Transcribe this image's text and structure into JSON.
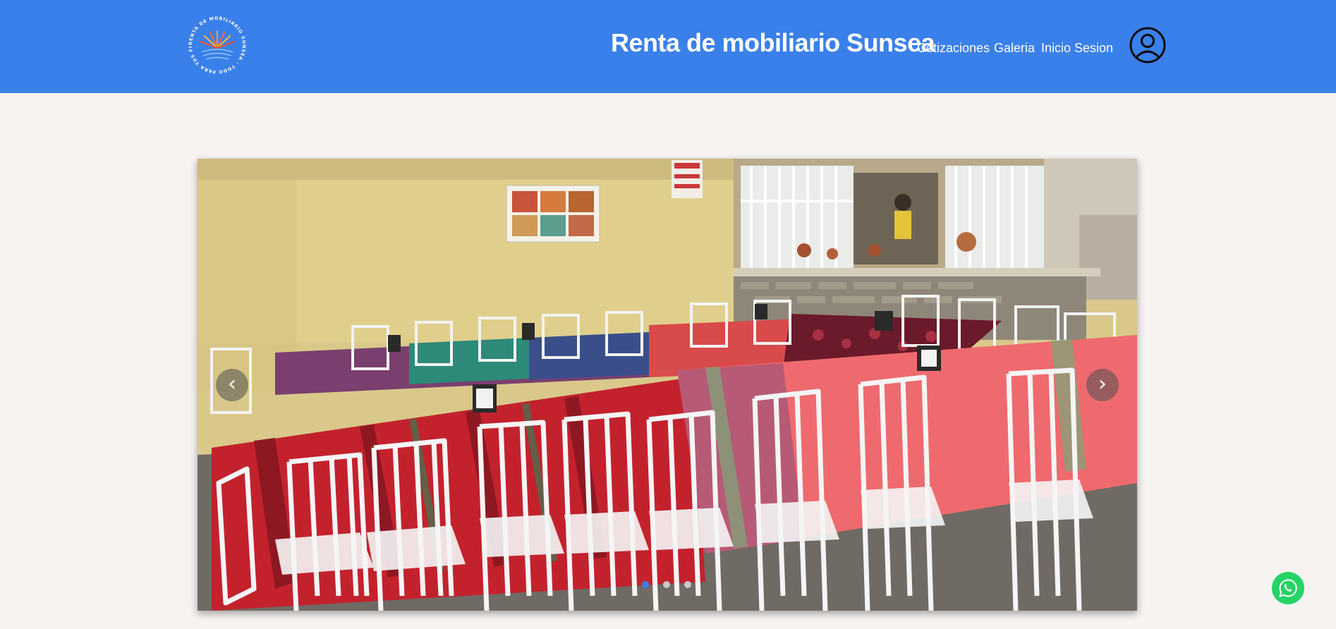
{
  "header": {
    "site_title": "Renta de mobiliario Sunsea",
    "logo_text": "RENTA DE MOBILIARIO SUNSEA · TODO PARA TUS FIESTAS",
    "nav": [
      {
        "label": "Cotizaciones"
      },
      {
        "label": "Galeria"
      },
      {
        "label": "Inicio Sesion"
      }
    ]
  },
  "carousel": {
    "prev_label": "‹",
    "next_label": "›",
    "active_slide": 1,
    "slide_count": 3
  },
  "colors": {
    "header_bg": "#3a80ea",
    "page_bg": "#f6f3f1",
    "whatsapp": "#25d366"
  },
  "icons": {
    "user": "user-circle-icon",
    "whatsapp": "whatsapp-icon"
  }
}
